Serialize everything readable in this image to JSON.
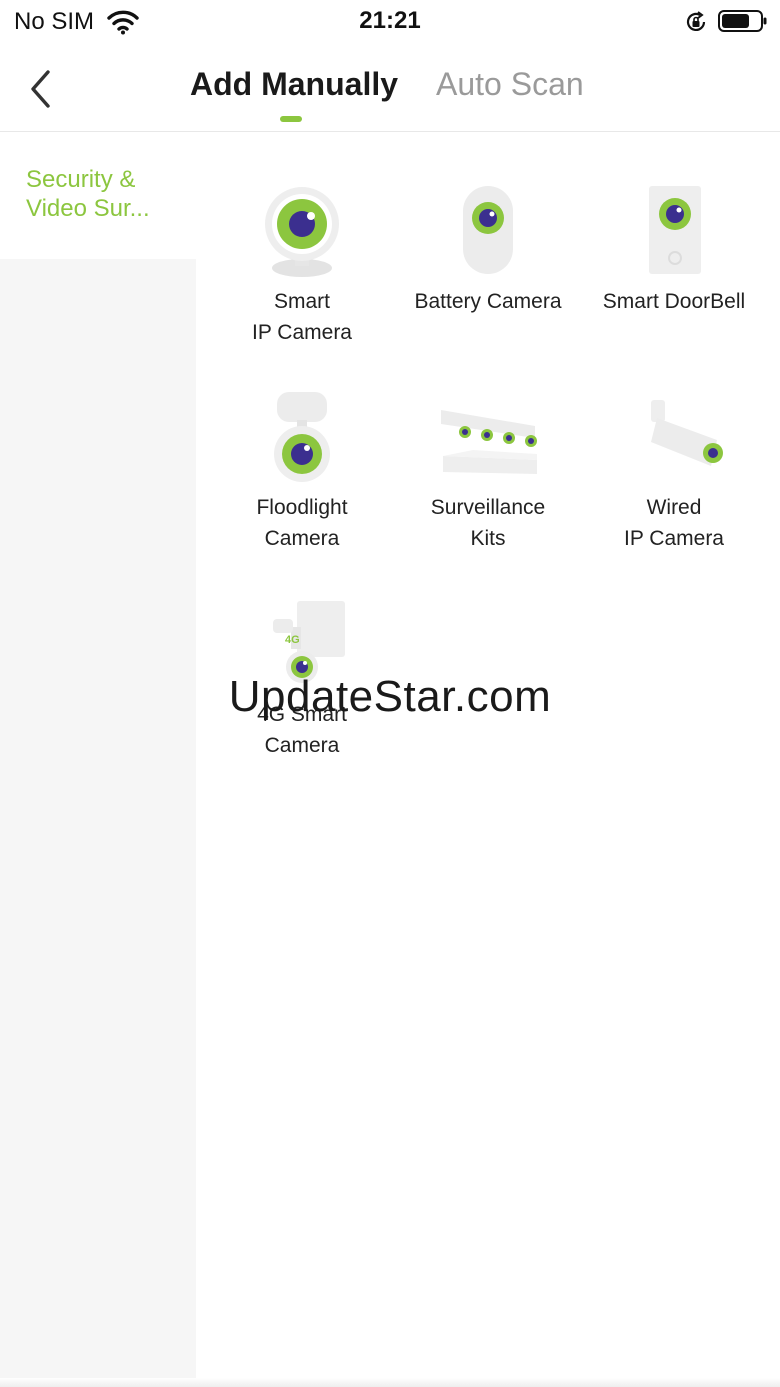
{
  "status_bar": {
    "carrier": "No SIM",
    "time": "21:21",
    "icons": [
      "wifi-icon",
      "orientation-lock-icon",
      "battery-icon"
    ]
  },
  "header": {
    "tabs": [
      {
        "label": "Add Manually",
        "active": true
      },
      {
        "label": "Auto Scan",
        "active": false
      }
    ]
  },
  "sidebar": {
    "items": [
      {
        "label": "Security & Video Sur...",
        "selected": true
      }
    ]
  },
  "devices": [
    {
      "line1": "Smart",
      "line2": "IP Camera",
      "icon": "smart-ip-camera-icon"
    },
    {
      "line1": "Battery Camera",
      "line2": "",
      "icon": "battery-camera-icon"
    },
    {
      "line1": "Smart DoorBell",
      "line2": "",
      "icon": "doorbell-icon"
    },
    {
      "line1": "Floodlight",
      "line2": "Camera",
      "icon": "floodlight-camera-icon"
    },
    {
      "line1": "Surveillance",
      "line2": "Kits",
      "icon": "surveillance-kit-icon"
    },
    {
      "line1": "Wired",
      "line2": "IP Camera",
      "icon": "wired-camera-icon"
    },
    {
      "line1": "4G Smart",
      "line2": "Camera",
      "icon": "4g-camera-icon"
    }
  ],
  "badge_4g": "4G",
  "watermark": "UpdateStar.com",
  "colors": {
    "accent": "#8cc63f",
    "lens": "#3b2f8f",
    "inactive_tab": "#9a9a9a",
    "sidebar_bg": "#f6f6f6"
  }
}
